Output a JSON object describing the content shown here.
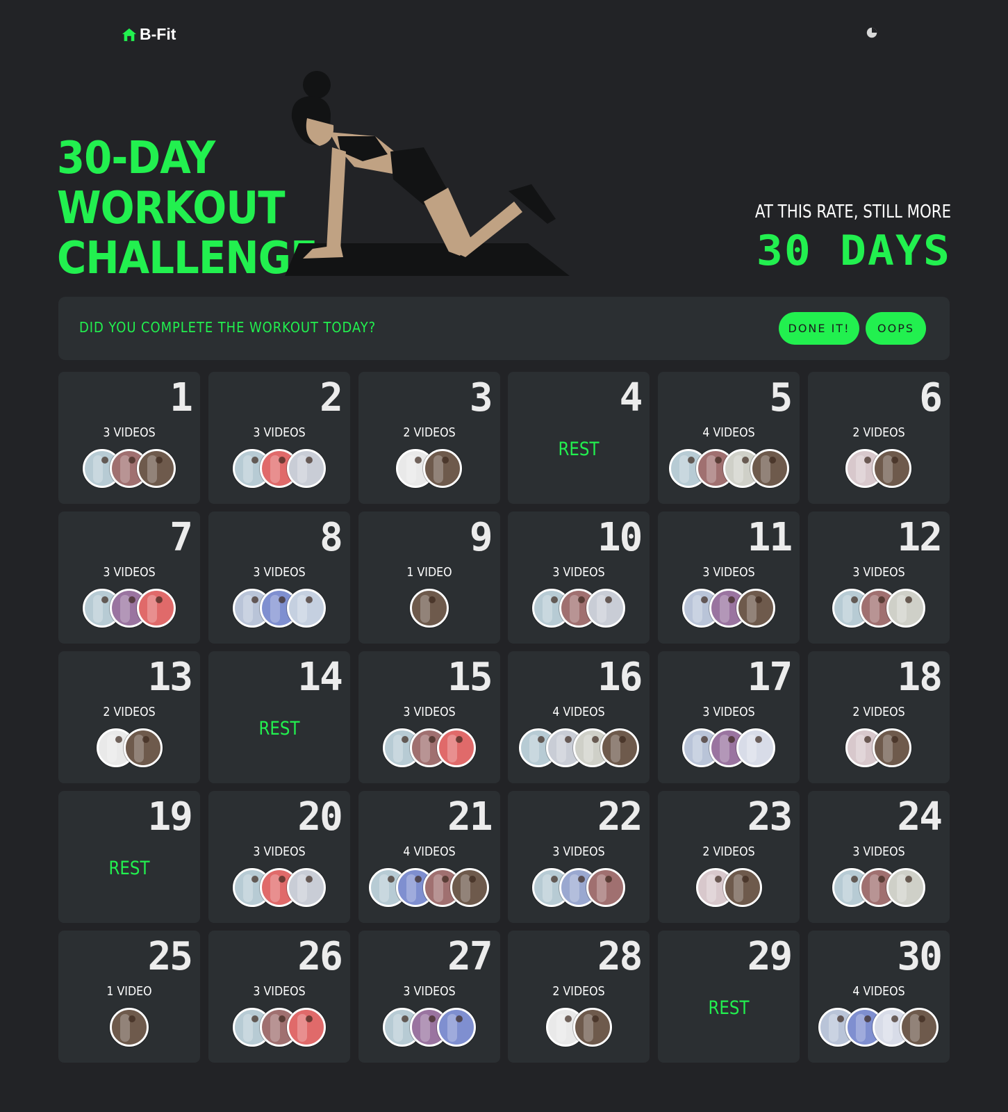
{
  "brand": {
    "name": "B-Fit",
    "accent": "#22f04f",
    "icon": "home-icon"
  },
  "header": {
    "toggle_icon": "pie-chart-icon"
  },
  "hero": {
    "title_lines": [
      "30-DAY",
      "WORKOUT",
      "CHALLENGE"
    ],
    "rate_label": "AT THIS RATE, STILL MORE",
    "rate_value": "30 DAYS"
  },
  "prompt": {
    "question": "DID YOU COMPLETE THE WORKOUT TODAY?",
    "done_label": "DONE IT!",
    "oops_label": "OOPS"
  },
  "days": [
    {
      "num": "1",
      "label": "3 VIDEOS",
      "thumbs": [
        "#b7cbd4",
        "#a07070",
        "#6e5a4c"
      ]
    },
    {
      "num": "2",
      "label": "3 VIDEOS",
      "thumbs": [
        "#b7cbd4",
        "#e06a6a",
        "#c9cdd6"
      ]
    },
    {
      "num": "3",
      "label": "2 VIDEOS",
      "thumbs": [
        "#e9e9e9",
        "#6e5a4c"
      ]
    },
    {
      "num": "4",
      "rest": "REST"
    },
    {
      "num": "5",
      "label": "4 VIDEOS",
      "thumbs": [
        "#b7cbd4",
        "#a07070",
        "#cfd0c8",
        "#6e5a4c"
      ]
    },
    {
      "num": "6",
      "label": "2 VIDEOS",
      "thumbs": [
        "#d8c8cc",
        "#6e5a4c"
      ]
    },
    {
      "num": "7",
      "label": "3 VIDEOS",
      "thumbs": [
        "#b7cbd4",
        "#9a74a0",
        "#e06a6a"
      ]
    },
    {
      "num": "8",
      "label": "3 VIDEOS",
      "thumbs": [
        "#b9c4d8",
        "#7f8fd0",
        "#c5d0e0"
      ]
    },
    {
      "num": "9",
      "label": "1 VIDEO",
      "thumbs": [
        "#6e5a4c"
      ]
    },
    {
      "num": "10",
      "label": "3 VIDEOS",
      "thumbs": [
        "#b7cbd4",
        "#a07070",
        "#c9cdd6"
      ]
    },
    {
      "num": "11",
      "label": "3 VIDEOS",
      "thumbs": [
        "#b9c4d8",
        "#9a74a0",
        "#6e5a4c"
      ]
    },
    {
      "num": "12",
      "label": "3 VIDEOS",
      "thumbs": [
        "#b7cbd4",
        "#a07070",
        "#cfd0c8"
      ]
    },
    {
      "num": "13",
      "label": "2 VIDEOS",
      "thumbs": [
        "#e9e9e9",
        "#6e5a4c"
      ]
    },
    {
      "num": "14",
      "rest": "REST"
    },
    {
      "num": "15",
      "label": "3 VIDEOS",
      "thumbs": [
        "#b7cbd4",
        "#a07070",
        "#e06a6a"
      ]
    },
    {
      "num": "16",
      "label": "4 VIDEOS",
      "thumbs": [
        "#b7cbd4",
        "#c9cdd6",
        "#cfd0c8",
        "#6e5a4c"
      ]
    },
    {
      "num": "17",
      "label": "3 VIDEOS",
      "thumbs": [
        "#b9c4d8",
        "#9a74a0",
        "#d8dce8"
      ]
    },
    {
      "num": "18",
      "label": "2 VIDEOS",
      "thumbs": [
        "#d8c8cc",
        "#6e5a4c"
      ]
    },
    {
      "num": "19",
      "rest": "REST"
    },
    {
      "num": "20",
      "label": "3 VIDEOS",
      "thumbs": [
        "#b7cbd4",
        "#e06a6a",
        "#c9cdd6"
      ]
    },
    {
      "num": "21",
      "label": "4 VIDEOS",
      "thumbs": [
        "#b7cbd4",
        "#7f8fd0",
        "#a07070",
        "#6e5a4c"
      ]
    },
    {
      "num": "22",
      "label": "3 VIDEOS",
      "thumbs": [
        "#b7cbd4",
        "#9aa8d0",
        "#a07070"
      ]
    },
    {
      "num": "23",
      "label": "2 VIDEOS",
      "thumbs": [
        "#d8c8cc",
        "#6e5a4c"
      ]
    },
    {
      "num": "24",
      "label": "3 VIDEOS",
      "thumbs": [
        "#b7cbd4",
        "#a07070",
        "#cfd0c8"
      ]
    },
    {
      "num": "25",
      "label": "1 VIDEO",
      "thumbs": [
        "#6e5a4c"
      ]
    },
    {
      "num": "26",
      "label": "3 VIDEOS",
      "thumbs": [
        "#b7cbd4",
        "#a07070",
        "#e06a6a"
      ]
    },
    {
      "num": "27",
      "label": "3 VIDEOS",
      "thumbs": [
        "#b7cbd4",
        "#9a74a0",
        "#7f8fd0"
      ]
    },
    {
      "num": "28",
      "label": "2 VIDEOS",
      "thumbs": [
        "#e9e9e9",
        "#6e5a4c"
      ]
    },
    {
      "num": "29",
      "rest": "REST"
    },
    {
      "num": "30",
      "label": "4 VIDEOS",
      "thumbs": [
        "#b9c4d8",
        "#7f8fd0",
        "#d8dce8",
        "#6e5a4c"
      ]
    }
  ]
}
